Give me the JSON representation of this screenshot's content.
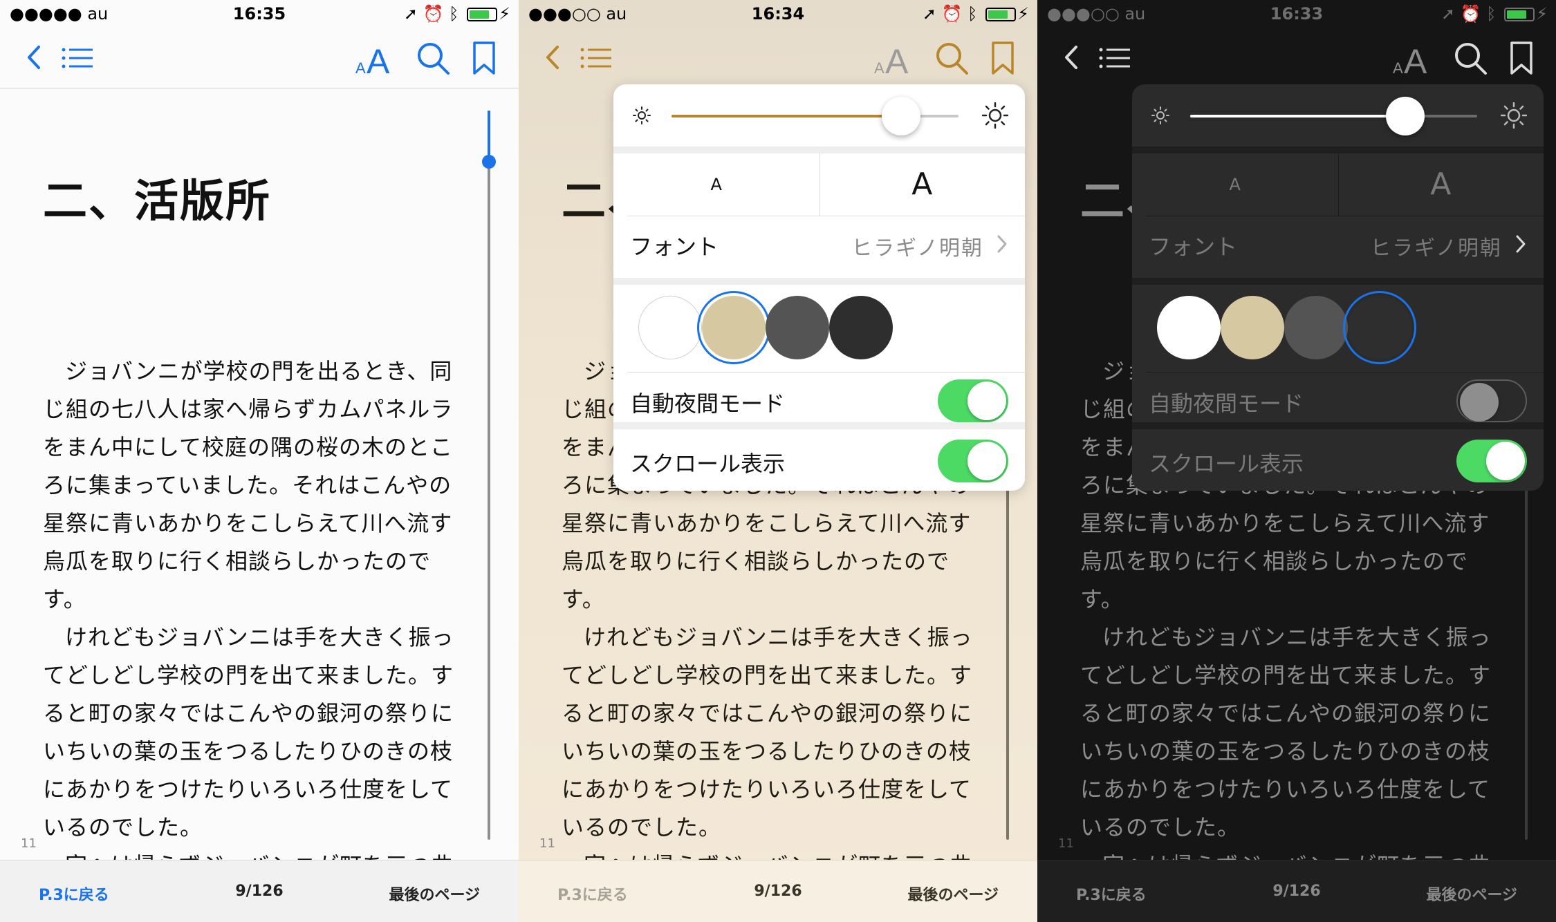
{
  "screens": [
    {
      "theme": "white",
      "status": {
        "carrier": "●●●●● au",
        "time": "16:35"
      },
      "accent": "#1a73e8",
      "popover_open": false
    },
    {
      "theme": "sepia",
      "status": {
        "carrier": "●●●○○ au",
        "time": "16:34"
      },
      "accent": "#b8862c",
      "popover_open": true,
      "popover": {
        "brightness": 0.8,
        "selected_theme": "sepia",
        "auto_night": true,
        "scroll_view": true
      }
    },
    {
      "theme": "night",
      "status": {
        "carrier": "●●●○○ au",
        "time": "16:33"
      },
      "accent": "#ffffff",
      "popover_open": true,
      "popover": {
        "brightness": 0.75,
        "selected_theme": "night",
        "auto_night": false,
        "scroll_view": true
      }
    }
  ],
  "book": {
    "chapter_title": "二、活版所",
    "paragraphs": [
      "ジョバンニが学校の門を出るとき、同じ組の七八人は家へ帰らずカムパネルラをまん中にして校庭の隅の桜の木のところに集まっていました。それはこんやの星祭に青いあかりをこしらえて川へ流す烏瓜を取りに行く相談らしかったのです。",
      "けれどもジョバンニは手を大きく振ってどしどし学校の門を出て来ました。すると町の家々ではこんやの銀河の祭りにいちいの葉の玉をつるしたりひのきの枝にあかりをつけたりいろいろ仕度をしているのでした。",
      "家へは帰らずジョバンニが町を三つ曲ってある大きな活版処にはいってすぐ"
    ],
    "page_marker": "11"
  },
  "toolbar": {
    "back_label": "P.3に戻る",
    "page_label": "9/126",
    "last_label": "最後のページ"
  },
  "settings": {
    "small_a": "A",
    "large_a": "A",
    "font_label": "フォント",
    "font_value": "ヒラギノ明朝",
    "auto_night_label": "自動夜間モード",
    "scroll_label": "スクロール表示",
    "theme_colors": {
      "white": "#ffffff",
      "sepia": "#d6c8a0",
      "gray": "#545454",
      "night": "#2e2e2e"
    }
  },
  "colors": {
    "blue": "#1a73e8",
    "gold": "#b8862c",
    "switch_on": "#4cd964"
  }
}
